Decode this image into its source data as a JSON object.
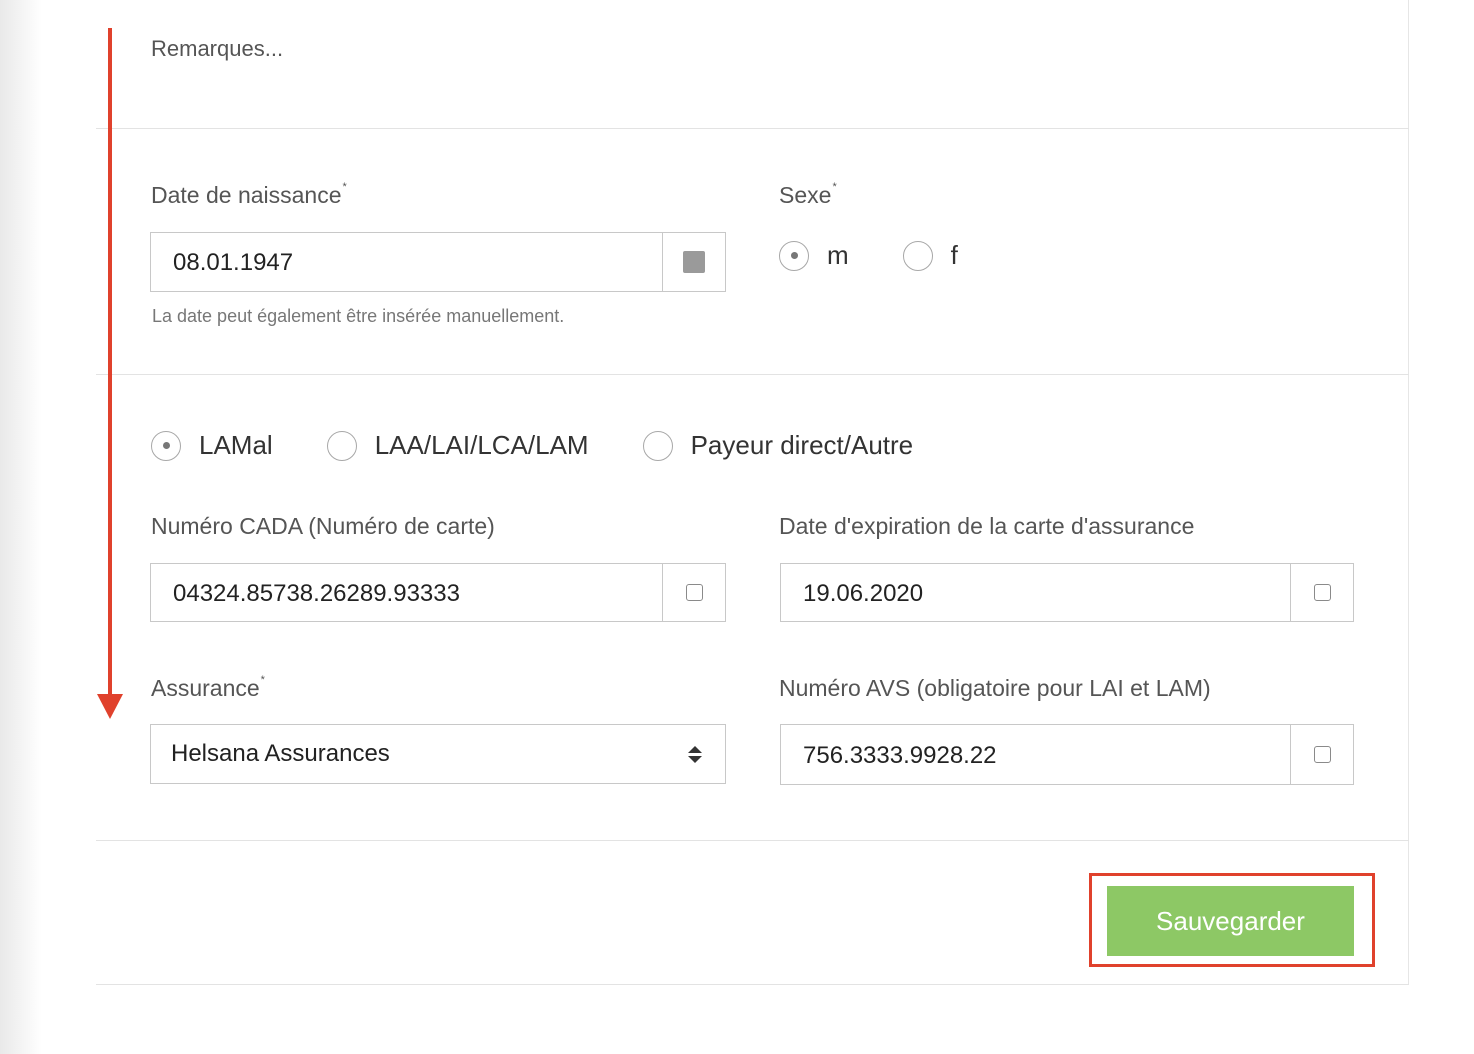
{
  "remarks": {
    "placeholder": "Remarques..."
  },
  "birthdate": {
    "label": "Date de naissance",
    "required_mark": "*",
    "value": "08.01.1947",
    "hint": "La date peut également être insérée manuellement."
  },
  "sex": {
    "label": "Sexe",
    "required_mark": "*",
    "options": [
      {
        "label": "m",
        "checked": true
      },
      {
        "label": "f",
        "checked": false
      }
    ]
  },
  "insurance_type": {
    "options": [
      {
        "label": "LAMal",
        "checked": true
      },
      {
        "label": "LAA/LAI/LCA/LAM",
        "checked": false
      },
      {
        "label": "Payeur direct/Autre",
        "checked": false
      }
    ]
  },
  "cada": {
    "label": "Numéro CADA (Numéro de carte)",
    "value": "04324.85738.26289.93333"
  },
  "card_expiry": {
    "label": "Date d'expiration de la carte d'assurance",
    "value": "19.06.2020"
  },
  "insurance": {
    "label": "Assurance",
    "required_mark": "*",
    "selected": "Helsana Assurances"
  },
  "avs": {
    "label": "Numéro AVS (obligatoire pour LAI et LAM)",
    "value": "756.3333.9928.22"
  },
  "actions": {
    "save_label": "Sauvegarder"
  },
  "colors": {
    "accent_annotation": "#e0412c",
    "save_button": "#8dc865"
  }
}
